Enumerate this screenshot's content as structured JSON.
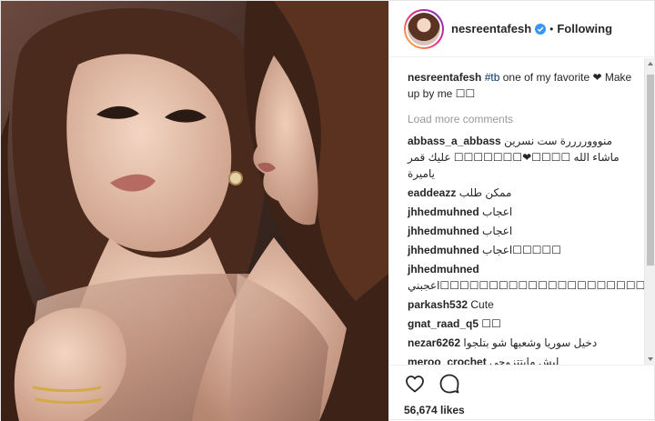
{
  "post": {
    "username": "nesreentafesh",
    "separator": "•",
    "follow_status": "Following",
    "caption_user": "nesreentafesh",
    "caption_tag": "#tb",
    "caption_text": " one of my favorite ❤ Make up by me ☐☐",
    "load_more": "Load more comments",
    "comments": [
      {
        "user": "abbass_a_abbass",
        "text": "منوووررررة ست نسرين ماشاء الله ☐☐☐☐❤☐☐☐☐☐☐☐ عليك قمر ياميرة"
      },
      {
        "user": "eaddeazz",
        "text": "ممكن طلب"
      },
      {
        "user": "jhhedmuhned",
        "text": "اعجاب"
      },
      {
        "user": "jhhedmuhned",
        "text": "اعجاب"
      },
      {
        "user": "jhhedmuhned",
        "text": "اعجاب☐☐☐☐☐"
      },
      {
        "user": "jhhedmuhned",
        "text": "اعجبني☐☐☐☐☐☐☐☐☐☐☐☐☐☐☐☐☐☐☐☐☐☐☐☐☐☐☐☐☐☐☐☐☐☐☐☐☐☐☐☐☐"
      },
      {
        "user": "parkash532",
        "text": "Cute"
      },
      {
        "user": "gnat_raad_q5",
        "text": "☐☐"
      },
      {
        "user": "nezar6262",
        "text": "دخيل سوريا وشعبها شو بتلجوا"
      },
      {
        "user": "meroo_crochet",
        "text": "ليش مابتتزوجي"
      }
    ],
    "likes": "56,674 likes"
  },
  "icons": {
    "verified": "verified-badge-icon",
    "like": "heart-icon",
    "comment": "comment-bubble-icon"
  },
  "colors": {
    "verified": "#3897f0",
    "hashtag": "#003569",
    "muted": "#999999",
    "text": "#262626"
  }
}
